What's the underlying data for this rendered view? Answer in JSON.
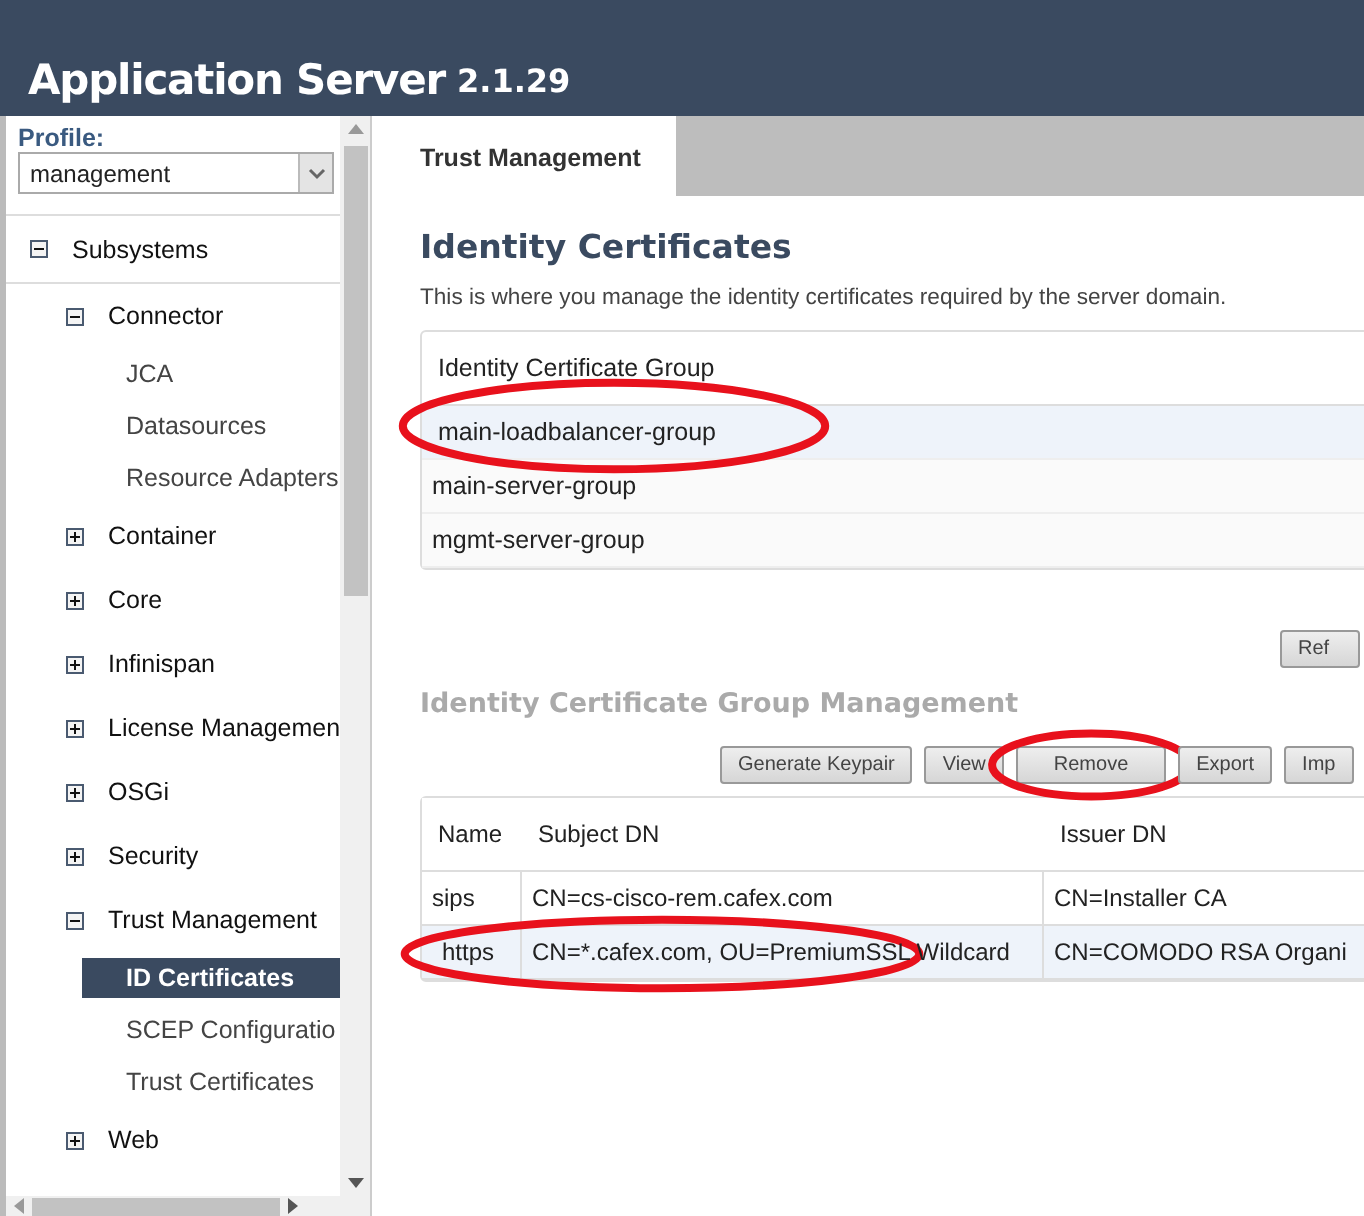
{
  "header": {
    "title": "Application Server",
    "version": "2.1.29"
  },
  "sidebar": {
    "profile_label": "Profile:",
    "profile_value": "management",
    "tree": [
      {
        "label": "Subsystems",
        "expanded": true,
        "selected": false,
        "children": [
          {
            "label": "Connector",
            "expanded": true,
            "selected": false,
            "children": [
              {
                "label": "JCA",
                "selected": false
              },
              {
                "label": "Datasources",
                "selected": false
              },
              {
                "label": "Resource Adapters",
                "selected": false
              }
            ]
          },
          {
            "label": "Container",
            "expanded": false,
            "selected": false
          },
          {
            "label": "Core",
            "expanded": false,
            "selected": false
          },
          {
            "label": "Infinispan",
            "expanded": false,
            "selected": false
          },
          {
            "label": "License Managemen",
            "expanded": false,
            "selected": false
          },
          {
            "label": "OSGi",
            "expanded": false,
            "selected": false
          },
          {
            "label": "Security",
            "expanded": false,
            "selected": false
          },
          {
            "label": "Trust Management",
            "expanded": true,
            "selected": false,
            "children": [
              {
                "label": "ID Certificates",
                "selected": true
              },
              {
                "label": "SCEP Configuratio",
                "selected": false
              },
              {
                "label": "Trust Certificates",
                "selected": false
              }
            ]
          },
          {
            "label": "Web",
            "expanded": false,
            "selected": false
          }
        ]
      }
    ]
  },
  "tabs": [
    {
      "label": "Trust Management",
      "selected": true
    }
  ],
  "heading": "Identity Certificates",
  "description": "This is where you manage the identity certificates required by the server domain.",
  "groups": {
    "column": "Identity Certificate Group",
    "rows": [
      {
        "name": "main-loadbalancer-group",
        "selected": true,
        "circled": true
      },
      {
        "name": "main-server-group",
        "selected": false,
        "circled": false
      },
      {
        "name": "mgmt-server-group",
        "selected": false,
        "circled": false
      }
    ]
  },
  "refresh_button": "Ref",
  "management_heading": "Identity Certificate Group Management",
  "buttons": [
    {
      "label": "Generate Keypair",
      "circled": false
    },
    {
      "label": "View",
      "circled": false
    },
    {
      "label": "Remove",
      "circled": true
    },
    {
      "label": "Export",
      "circled": false
    },
    {
      "label": "Imp",
      "circled": false
    }
  ],
  "table": {
    "columns": [
      "Name",
      "Subject DN",
      "Issuer DN"
    ],
    "rows": [
      {
        "cells": [
          "sips",
          "CN=cs-cisco-rem.cafex.com",
          "CN=Installer CA"
        ],
        "selected": false,
        "circled": false
      },
      {
        "cells": [
          "https",
          "CN=*.cafex.com, OU=PremiumSSL Wildcard",
          "CN=COMODO RSA Organi"
        ],
        "selected": true,
        "circled": true
      }
    ]
  }
}
